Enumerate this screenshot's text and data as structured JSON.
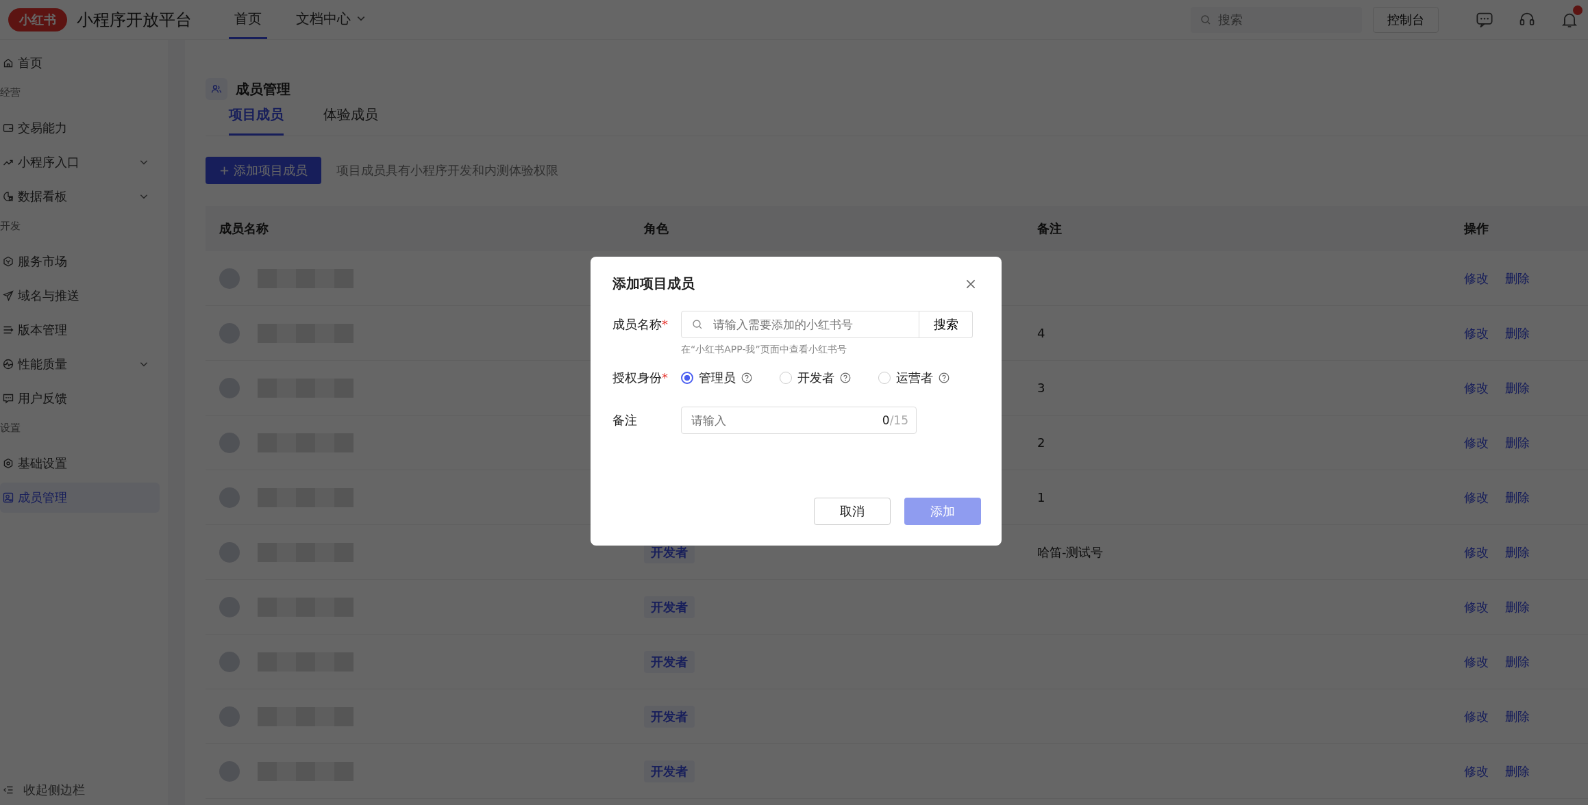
{
  "header": {
    "logo": "小红书",
    "title": "小程序开放平台",
    "nav": [
      {
        "label": "首页",
        "selected": true,
        "has_dropdown": false
      },
      {
        "label": "文档中心",
        "selected": false,
        "has_dropdown": true
      }
    ],
    "search": {
      "placeholder": "搜索"
    },
    "console_button": "控制台"
  },
  "sidebar": {
    "items": [
      {
        "kind": "item",
        "label": "首页",
        "has_submenu": false,
        "selected": false
      },
      {
        "kind": "heading",
        "label": "经营"
      },
      {
        "kind": "item",
        "label": "交易能力",
        "has_submenu": false,
        "selected": false
      },
      {
        "kind": "item",
        "label": "小程序入口",
        "has_submenu": true,
        "selected": false
      },
      {
        "kind": "item",
        "label": "数据看板",
        "has_submenu": true,
        "selected": false
      },
      {
        "kind": "heading",
        "label": "开发"
      },
      {
        "kind": "item",
        "label": "服务市场",
        "has_submenu": false,
        "selected": false
      },
      {
        "kind": "item",
        "label": "域名与推送",
        "has_submenu": false,
        "selected": false
      },
      {
        "kind": "item",
        "label": "版本管理",
        "has_submenu": false,
        "selected": false
      },
      {
        "kind": "item",
        "label": "性能质量",
        "has_submenu": true,
        "selected": false
      },
      {
        "kind": "item",
        "label": "用户反馈",
        "has_submenu": false,
        "selected": false
      },
      {
        "kind": "heading",
        "label": "设置"
      },
      {
        "kind": "item",
        "label": "基础设置",
        "has_submenu": false,
        "selected": false
      },
      {
        "kind": "item",
        "label": "成员管理",
        "has_submenu": false,
        "selected": true
      }
    ],
    "collapse": "收起侧边栏"
  },
  "page": {
    "title": "成员管理",
    "tabs": [
      {
        "label": "项目成员",
        "selected": true
      },
      {
        "label": "体验成员",
        "selected": false
      }
    ],
    "add_button": "+ 添加项目成员",
    "hint": "项目成员具有小程序开发和内测体验权限"
  },
  "table": {
    "columns": [
      "成员名称",
      "角色",
      "备注",
      "操作"
    ],
    "rows": [
      {
        "actions": [
          "修改",
          "删除"
        ]
      },
      {
        "remark": "4",
        "actions": [
          "修改",
          "删除"
        ]
      },
      {
        "remark": "3",
        "actions": [
          "修改",
          "删除"
        ]
      },
      {
        "remark": "2",
        "actions": [
          "修改",
          "删除"
        ]
      },
      {
        "remark": "1",
        "actions": [
          "修改",
          "删除"
        ]
      },
      {
        "role": "开发者",
        "remark": "哈笛-测试号",
        "actions": [
          "修改",
          "删除"
        ]
      },
      {
        "role": "开发者",
        "actions": [
          "修改",
          "删除"
        ]
      },
      {
        "role": "开发者",
        "actions": [
          "修改",
          "删除"
        ]
      },
      {
        "role": "开发者",
        "actions": [
          "修改",
          "删除"
        ]
      },
      {
        "role": "开发者",
        "actions": [
          "修改",
          "删除"
        ]
      }
    ]
  },
  "dialog": {
    "title": "添加项目成员",
    "name_field": {
      "label": "成员名称",
      "required_mark": "*",
      "placeholder": "请输入需要添加的小红书号",
      "button": "搜索",
      "help": "在“小红书APP-我”页面中查看小红书号"
    },
    "role_field": {
      "label": "授权身份",
      "required_mark": "*",
      "options": [
        {
          "label": "管理员",
          "selected": true
        },
        {
          "label": "开发者",
          "selected": false
        },
        {
          "label": "运营者",
          "selected": false
        }
      ]
    },
    "remark_field": {
      "label": "备注",
      "placeholder": "请输入",
      "count": "0",
      "max": "/15"
    },
    "buttons": [
      {
        "label": "取消",
        "kind": "secondary",
        "disabled": false
      },
      {
        "label": "添加",
        "kind": "primary",
        "disabled": true
      }
    ]
  }
}
